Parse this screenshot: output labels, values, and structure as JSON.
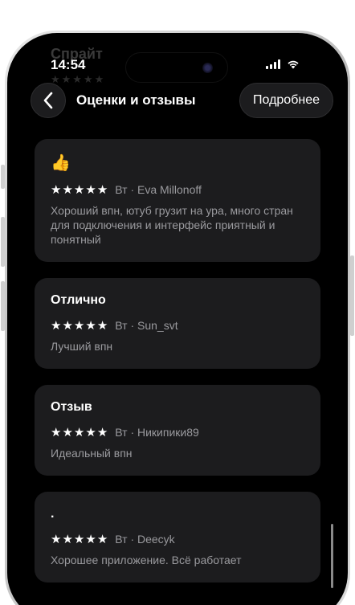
{
  "status_bar": {
    "time": "14:54"
  },
  "background_header": {
    "title": "Спрайт",
    "stars": "★★★★★"
  },
  "nav": {
    "title": "Оценки и отзывы",
    "more_label": "Подробнее"
  },
  "reviews": [
    {
      "title": "👍",
      "stars": 5,
      "meta": "Вт · Eva Millonoff",
      "text": "Хороший впн, ютуб грузит на ура, много стран для подключения и интерфейс приятный и понятный"
    },
    {
      "title": "Отлично",
      "stars": 5,
      "meta": "Вт · Sun_svt",
      "text": "Лучший впн"
    },
    {
      "title": "Отзыв",
      "stars": 5,
      "meta": "Вт · Никипики89",
      "text": "Идеальный впн"
    },
    {
      "title": ".",
      "stars": 5,
      "meta": "Вт · Deecyk",
      "text": "Хорошее приложение. Всё работает"
    }
  ],
  "colors": {
    "background": "#000000",
    "card": "#1c1c1e",
    "text_primary": "#ffffff",
    "text_secondary": "#9a9a9e"
  }
}
